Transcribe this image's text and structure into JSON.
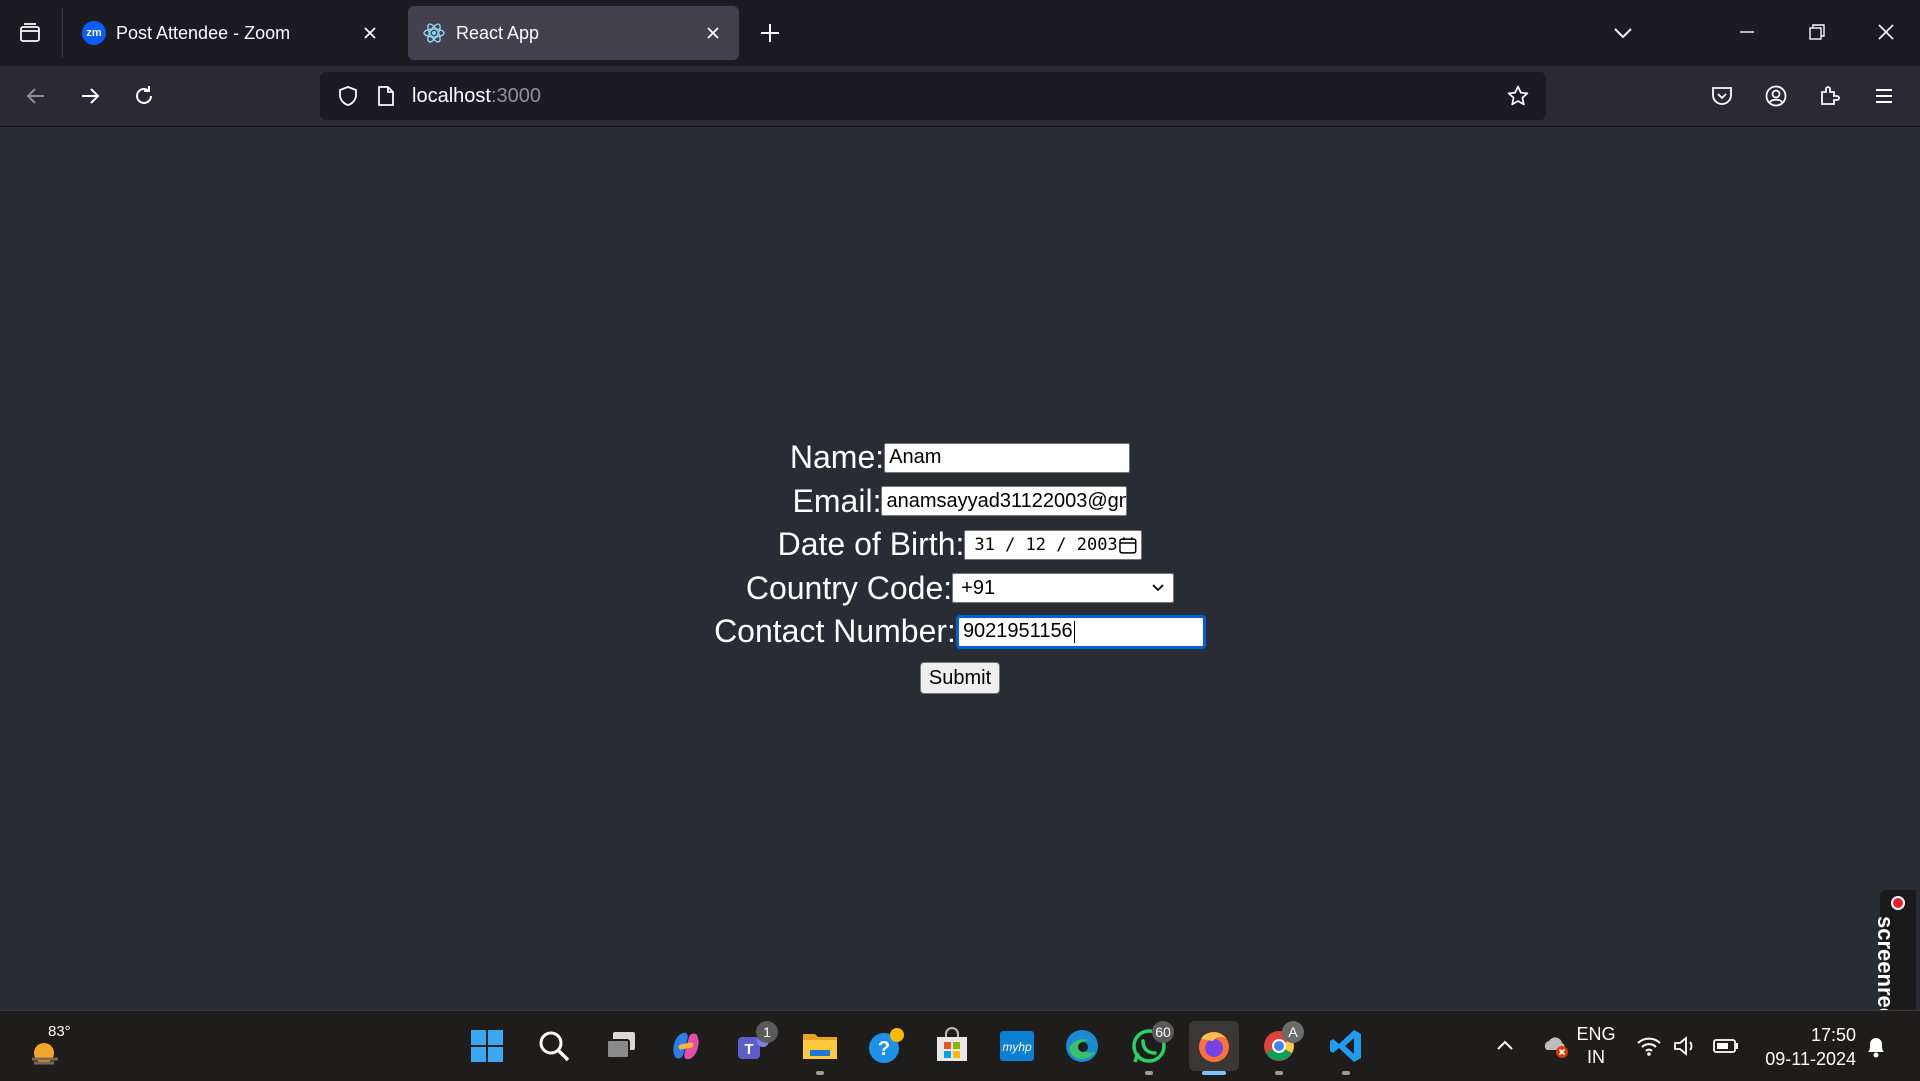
{
  "browser": {
    "tabs": [
      {
        "title": "Post Attendee - Zoom",
        "favicon": "zoom-icon",
        "favicon_text": "zm",
        "active": false
      },
      {
        "title": "React App",
        "favicon": "react-icon",
        "active": true
      }
    ],
    "url_host": "localhost",
    "url_port": ":3000"
  },
  "form": {
    "name_label": "Name:",
    "name_value": "Anam",
    "email_label": "Email:",
    "email_value": "anamsayyad31122003@gn",
    "dob_label": "Date of Birth:",
    "dob_value": "31 / 12 / 2003",
    "country_label": "Country Code:",
    "country_value": "+91",
    "contact_label": "Contact Number:",
    "contact_value": "9021951156",
    "submit_label": "Submit"
  },
  "screenrec": {
    "label": "screenrec"
  },
  "taskbar": {
    "weather_temp": "83°",
    "teams_badge": "1",
    "whatsapp_badge": "60",
    "chrome_profile": "A",
    "hp_label": "myhp",
    "lang_line1": "ENG",
    "lang_line2": "IN",
    "time": "17:50",
    "date": "09-11-2024"
  },
  "colors": {
    "page_bg": "#282c34",
    "focus_ring": "#0060df",
    "taskbar_bg": "#1f1d1b",
    "tab_active_bg": "#42414d"
  }
}
